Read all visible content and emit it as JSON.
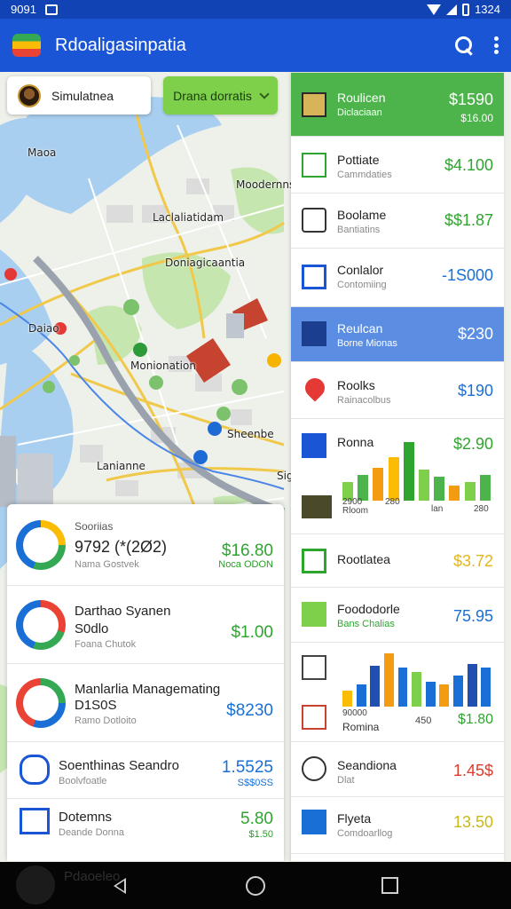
{
  "status": {
    "time_left": "9091",
    "time_right": "1324"
  },
  "app": {
    "title": "Rdoaligasinpatia"
  },
  "map": {
    "location_chip": "Simulatnea",
    "donate_button": "Drana dorratis",
    "labels": [
      "Maoa",
      "Moodernns",
      "Laclaliatidam",
      "Doniagicaantia",
      "Daiao",
      "Monionation",
      "Sheenbe",
      "Lanianne",
      "Sig"
    ]
  },
  "right_panel": {
    "items": [
      {
        "name": "Roulicen",
        "sub": "Diclaciaan",
        "value": "$1590",
        "value2": "$16.00",
        "value_color": "#ffffff"
      },
      {
        "name": "Pottiate",
        "sub": "Cammdaties",
        "value": "$4.100",
        "value_color": "#2ea52e"
      },
      {
        "name": "Boolame",
        "sub": "Bantiatins",
        "value": "$$1.87",
        "value_color": "#2ea52e"
      },
      {
        "name": "Conlalor",
        "sub": "Contomiing",
        "value": "-1S000",
        "value_color": "#1a6fd6"
      },
      {
        "name": "Reulcan",
        "sub": "Borne Mionas",
        "value": "$230",
        "value_color": "#ffffff"
      },
      {
        "name": "Roolks",
        "sub": "Rainacolbus",
        "value": "$190",
        "value_color": "#1a6fd6"
      },
      {
        "name": "Ronna",
        "value": "$2.90",
        "value_color": "#2ea52e",
        "chart_x1": "2900",
        "chart_x2": "280",
        "chart_x3": "lan",
        "chart_x4": "280",
        "chart_cap": "Rloom"
      },
      {
        "name": "Rootlatea",
        "value": "$3.72",
        "value_color": "#e3b51c"
      },
      {
        "name": "Foododorle",
        "sub": "Bans Chalias",
        "value": "75.95",
        "value_color": "#1a6fd6"
      },
      {
        "name": "Romina",
        "value": "$1.80",
        "value_color": "#2ea52e",
        "chart_x1": "90000",
        "chart_x2": "450",
        "chart_cap": "Romina"
      },
      {
        "name": "Seandiona",
        "sub": "Dlat",
        "value": "1.45$",
        "value_color": "#e03a2a"
      },
      {
        "name": "Flyeta",
        "sub": "Comdoarllog",
        "value": "13.50",
        "value_color": "#c9b81a"
      }
    ],
    "chart_a": {
      "values": [
        22,
        30,
        38,
        50,
        68,
        36,
        28,
        18,
        22,
        30
      ]
    },
    "chart_b": {
      "values": [
        16,
        22,
        40,
        52,
        38,
        34,
        24,
        22,
        30,
        42,
        38
      ]
    }
  },
  "left_panel": {
    "rows": [
      {
        "title": "Sooriias",
        "title2": "9792 (*(2Ø2)",
        "sub": "Nama Gostvek",
        "value": "$16.80",
        "value2": "Noca ODON",
        "value_color": "#2ea52e"
      },
      {
        "title": "Darthao Syanen",
        "title2": "S0dlo",
        "sub": "Foana Chutok",
        "value": "$1.00",
        "value_color": "#2ea52e"
      },
      {
        "title": "Manlarlia Managemating",
        "title2": "D1S0S",
        "sub": "Ramo Dotloito",
        "value": "$8230",
        "value_color": "#1a6fd6"
      },
      {
        "title": "Soenthinas Seandro",
        "sub": "Boolvfoatle",
        "value": "1.5525",
        "value2": "S$$0SS",
        "value_color": "#1a6fd6"
      },
      {
        "title": "Dotemns",
        "sub": "Deande Donna",
        "value": "5.80",
        "value2": "$1.50",
        "value_color": "#2ea52e"
      }
    ]
  },
  "navbar": {
    "fab_text": "Pdaoeleo"
  }
}
